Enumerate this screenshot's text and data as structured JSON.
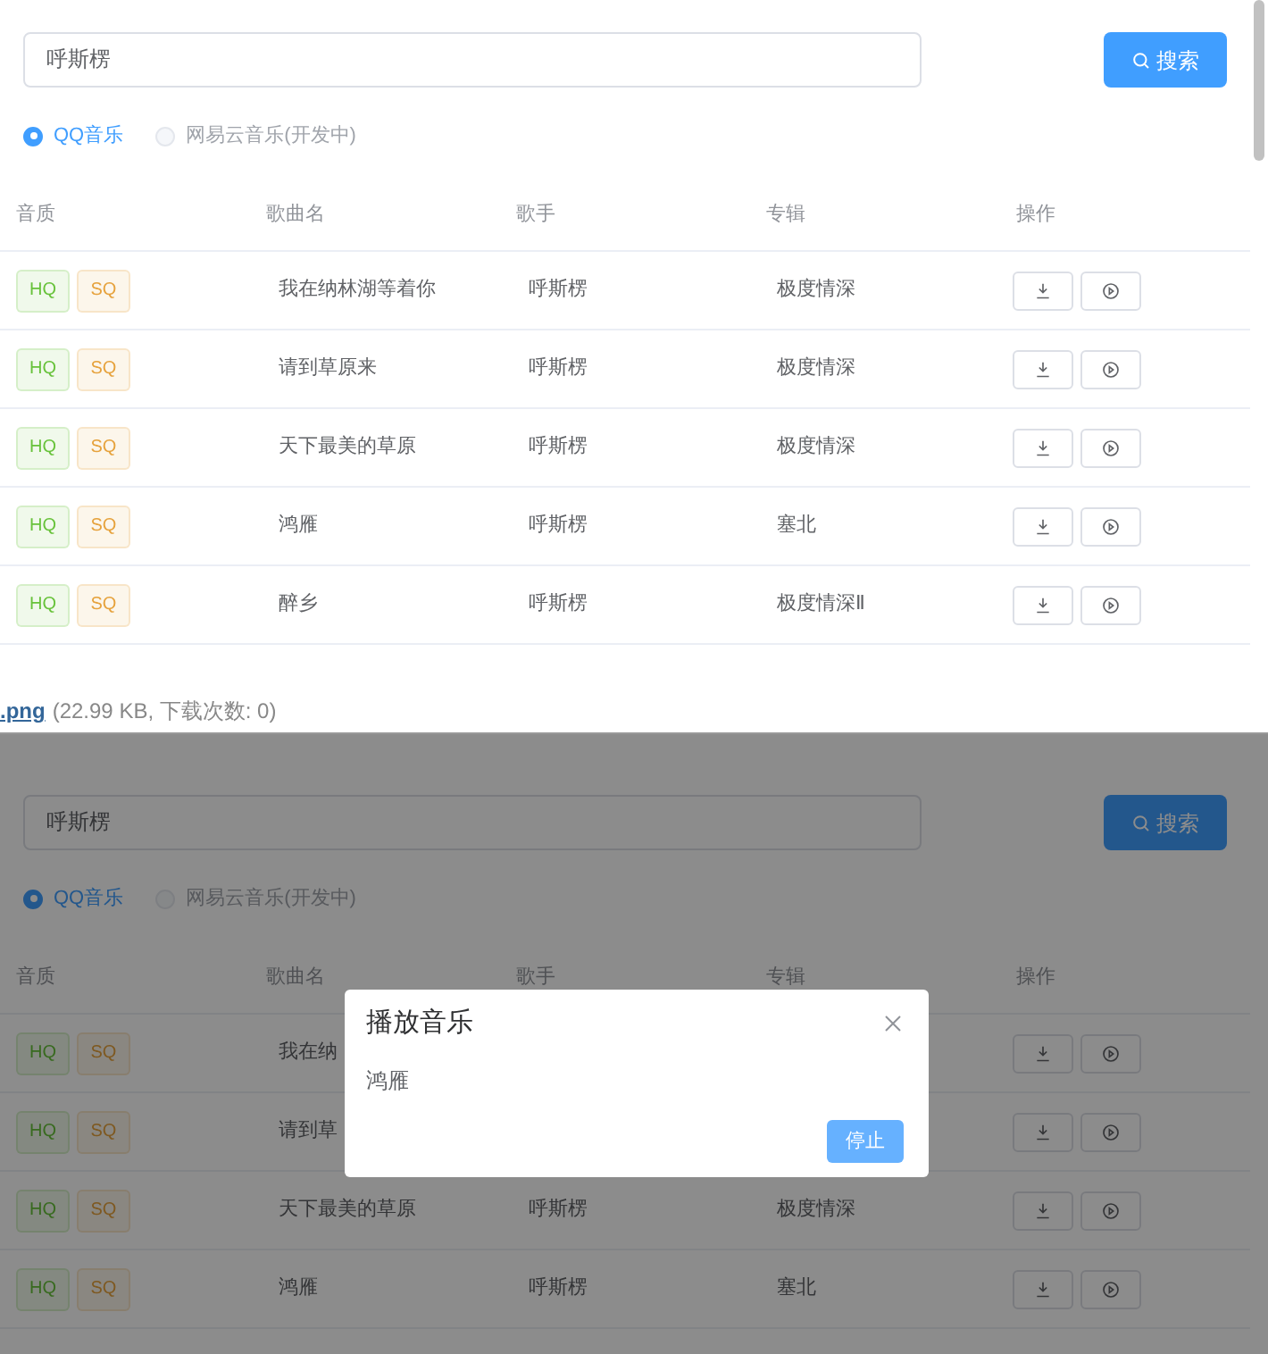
{
  "panels": [
    {
      "search": {
        "value": "呼斯楞"
      },
      "search_button": "搜索",
      "sources": [
        {
          "label": "QQ音乐",
          "selected": true,
          "disabled": false
        },
        {
          "label": "网易云音乐(开发中)",
          "selected": false,
          "disabled": true
        }
      ],
      "table": {
        "columns": [
          "音质",
          "歌曲名",
          "歌手",
          "专辑",
          "操作"
        ],
        "rows": [
          {
            "badges": [
              {
                "label": "HQ",
                "kind": "hq"
              },
              {
                "label": "SQ",
                "kind": "sq"
              }
            ],
            "song": "我在纳林湖等着你",
            "singer": "呼斯楞",
            "album": "极度情深"
          },
          {
            "badges": [
              {
                "label": "HQ",
                "kind": "hq"
              },
              {
                "label": "SQ",
                "kind": "sq"
              }
            ],
            "song": "请到草原来",
            "singer": "呼斯楞",
            "album": "极度情深"
          },
          {
            "badges": [
              {
                "label": "HQ",
                "kind": "hq"
              },
              {
                "label": "SQ",
                "kind": "sq"
              }
            ],
            "song": "天下最美的草原",
            "singer": "呼斯楞",
            "album": "极度情深"
          },
          {
            "badges": [
              {
                "label": "HQ",
                "kind": "hq"
              },
              {
                "label": "SQ",
                "kind": "sq"
              }
            ],
            "song": "鸿雁",
            "singer": "呼斯楞",
            "album": "塞北"
          },
          {
            "badges": [
              {
                "label": "HQ",
                "kind": "hq"
              },
              {
                "label": "SQ",
                "kind": "sq"
              }
            ],
            "song": "醉乡",
            "singer": "呼斯楞",
            "album": "极度情深Ⅱ"
          }
        ]
      },
      "attachment": {
        "link": ".png",
        "info": "(22.99 KB, 下载次数: 0)"
      }
    },
    {
      "search": {
        "value": "呼斯楞"
      },
      "search_button": "搜索",
      "sources": [
        {
          "label": "QQ音乐",
          "selected": true,
          "disabled": false
        },
        {
          "label": "网易云音乐(开发中)",
          "selected": false,
          "disabled": true
        }
      ],
      "table": {
        "columns": [
          "音质",
          "歌曲名",
          "歌手",
          "专辑",
          "操作"
        ],
        "rows": [
          {
            "badges": [
              {
                "label": "HQ",
                "kind": "hq"
              },
              {
                "label": "SQ",
                "kind": "sq"
              }
            ],
            "song": "我在纳"
          },
          {
            "badges": [
              {
                "label": "HQ",
                "kind": "hq"
              },
              {
                "label": "SQ",
                "kind": "sq"
              }
            ],
            "song": "请到草"
          },
          {
            "badges": [
              {
                "label": "HQ",
                "kind": "hq"
              },
              {
                "label": "SQ",
                "kind": "sq"
              }
            ],
            "song": "天下最美的草原",
            "singer": "呼斯楞",
            "album": "极度情深"
          },
          {
            "badges": [
              {
                "label": "HQ",
                "kind": "hq"
              },
              {
                "label": "SQ",
                "kind": "sq"
              }
            ],
            "song": "鸿雁",
            "singer": "呼斯楞",
            "album": "塞北"
          }
        ]
      },
      "dialog": {
        "title": "播放音乐",
        "body": "鸿雁",
        "button": "停止"
      }
    }
  ]
}
